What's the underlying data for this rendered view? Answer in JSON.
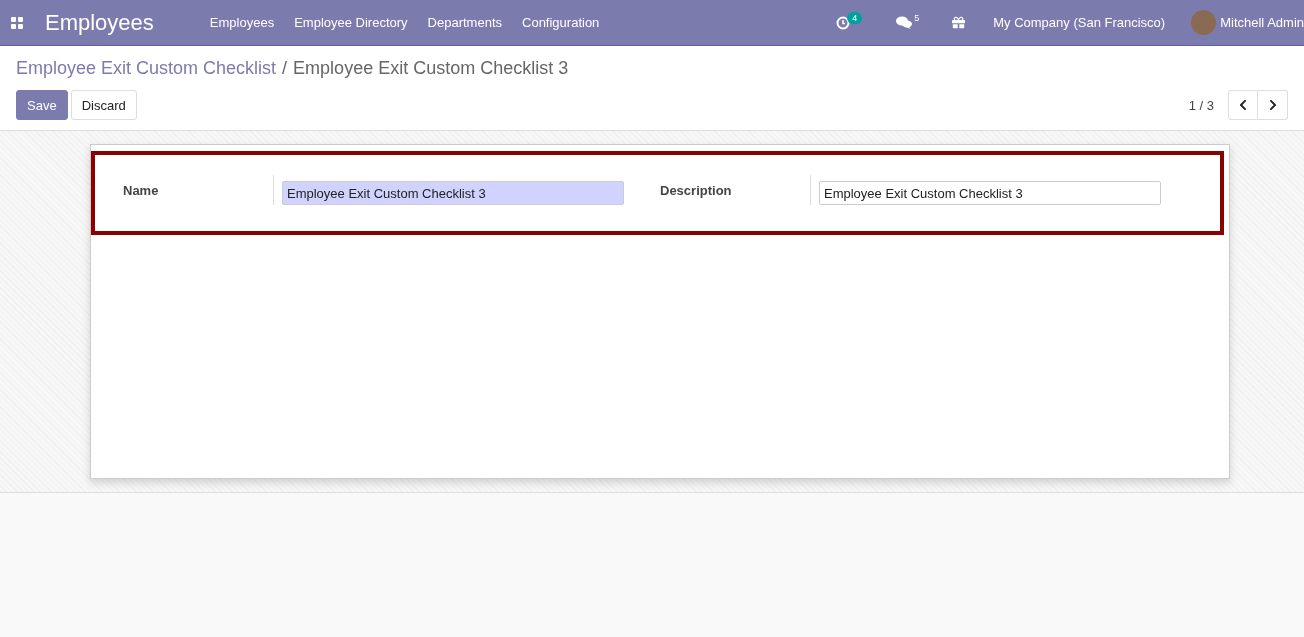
{
  "navbar": {
    "app_title": "Employees",
    "menu": [
      "Employees",
      "Employee Directory",
      "Departments",
      "Configuration"
    ],
    "activity_count": "4",
    "message_count": "5",
    "company": "My Company (San Francisco)",
    "user": "Mitchell Admin"
  },
  "breadcrumb": {
    "parent": "Employee Exit Custom Checklist",
    "separator": "/",
    "current": "Employee Exit Custom Checklist 3"
  },
  "buttons": [
    {
      "label": "Save",
      "kind": "primary"
    },
    {
      "label": "Discard",
      "kind": "secondary"
    }
  ],
  "pager": {
    "value": "1 / 3"
  },
  "form": {
    "highlighted": true,
    "fields": [
      {
        "label": "Name",
        "value": "Employee Exit Custom Checklist 3",
        "focused": true
      },
      {
        "label": "Description",
        "value": "Employee Exit Custom Checklist 3",
        "focused": false
      }
    ]
  }
}
